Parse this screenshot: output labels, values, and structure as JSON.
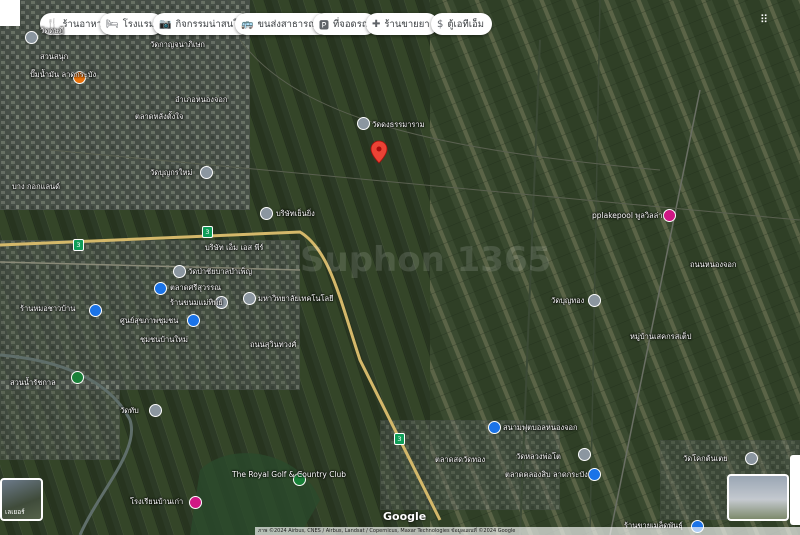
{
  "categories": [
    {
      "label": "ร้านอาหาร",
      "icon": "fork-knife-icon"
    },
    {
      "label": "โรงแรม",
      "icon": "bed-icon"
    },
    {
      "label": "กิจกรรมน่าสนใจ",
      "icon": "camera-icon"
    },
    {
      "label": "ขนส่งสาธารณะ",
      "icon": "bus-icon"
    },
    {
      "label": "ที่จอดรถ",
      "icon": "parking-icon"
    },
    {
      "label": "ร้านขายยา",
      "icon": "pharmacy-icon"
    },
    {
      "label": "ตู้เอทีเอ็ม",
      "icon": "atm-icon"
    }
  ],
  "places": [
    {
      "text": "วัดดุษฎี",
      "kind": "gray"
    },
    {
      "text": "สวนสนุก",
      "kind": "none"
    },
    {
      "text": "วัดกาญจนาภิเษก",
      "kind": "none"
    },
    {
      "text": "อำเภอหนองจอก",
      "kind": "none"
    },
    {
      "text": "ตลาดหลังตั้งใจ",
      "kind": "none"
    },
    {
      "text": "ปั๊มน้ำมัน ลาดกระบัง",
      "kind": "orange"
    },
    {
      "text": "บาง กอกแลนด์",
      "kind": "none"
    },
    {
      "text": "วัดดงธรรมาราม",
      "kind": "gray"
    },
    {
      "text": "วัดบุญกรใหม่",
      "kind": "gray"
    },
    {
      "text": "บริษัทเย็นยิ่ง",
      "kind": "gray"
    },
    {
      "text": "บริษัท เอ็ม เอส พีร์",
      "kind": "gray"
    },
    {
      "text": "วัดป่าชัยบาลบำเพ็ญ",
      "kind": "gray"
    },
    {
      "text": "ตลาดศรีสุวรรณ",
      "kind": "blue"
    },
    {
      "text": "ร้านหมอชาวบ้าน",
      "kind": "blue"
    },
    {
      "text": "ร้านขนมแม่ทิพย์",
      "kind": "gray"
    },
    {
      "text": "มหาวิทยาลัยเทคโนโลยี",
      "kind": "gray"
    },
    {
      "text": "ศูนย์สุขภาพชุมชน",
      "kind": "blue"
    },
    {
      "text": "ชุมชนบ้านใหม่",
      "kind": "none"
    },
    {
      "text": "pplakepool พูลวิลล่า",
      "kind": "pink"
    },
    {
      "text": "วัดบุญทอง",
      "kind": "gray"
    },
    {
      "text": "วัดโคกต้นเตย",
      "kind": "gray"
    },
    {
      "text": "หมู่บ้านเสคกรสเต็ป",
      "kind": "none"
    },
    {
      "text": "สนามฟุตบอลหนองจอก",
      "kind": "blue"
    },
    {
      "text": "ตลาดคลองสิบ ลาดกระบัง",
      "kind": "blue"
    },
    {
      "text": "วัดทับ",
      "kind": "gray"
    },
    {
      "text": "The Royal Golf & Country Club",
      "kind": "green"
    },
    {
      "text": "โรงเรียนบ้านเก่า",
      "kind": "pink"
    },
    {
      "text": "วัดหลวงพ่อโต",
      "kind": "gray"
    },
    {
      "text": "ร้านขายเมล็ดพันธุ์",
      "kind": "blue"
    },
    {
      "text": "สวนน้ำรัชกาล",
      "kind": "green"
    },
    {
      "text": "ตลาดสดวัดทอง",
      "kind": "none"
    }
  ],
  "roads": [
    {
      "name": "ถนนสุวินทวงศ์"
    },
    {
      "name": "ถนนหนองจอก"
    }
  ],
  "highway": {
    "number": "3"
  },
  "selected_pin": {
    "label": "ตำแหน่งที่เลือก"
  },
  "watermark": "Suphon 1365",
  "map_controls": {
    "layers_label": "เลเยอร์",
    "google": "Google",
    "attribution": "ภาพ ©2024 Airbus, CNES / Airbus, Landsat / Copernicus, Maxar Technologies ข้อมูลแผนที่ ©2024 Google"
  },
  "colors": {
    "road": "#d4b86a",
    "pin": "#ea4335",
    "chip_bg": "#ffffff"
  }
}
